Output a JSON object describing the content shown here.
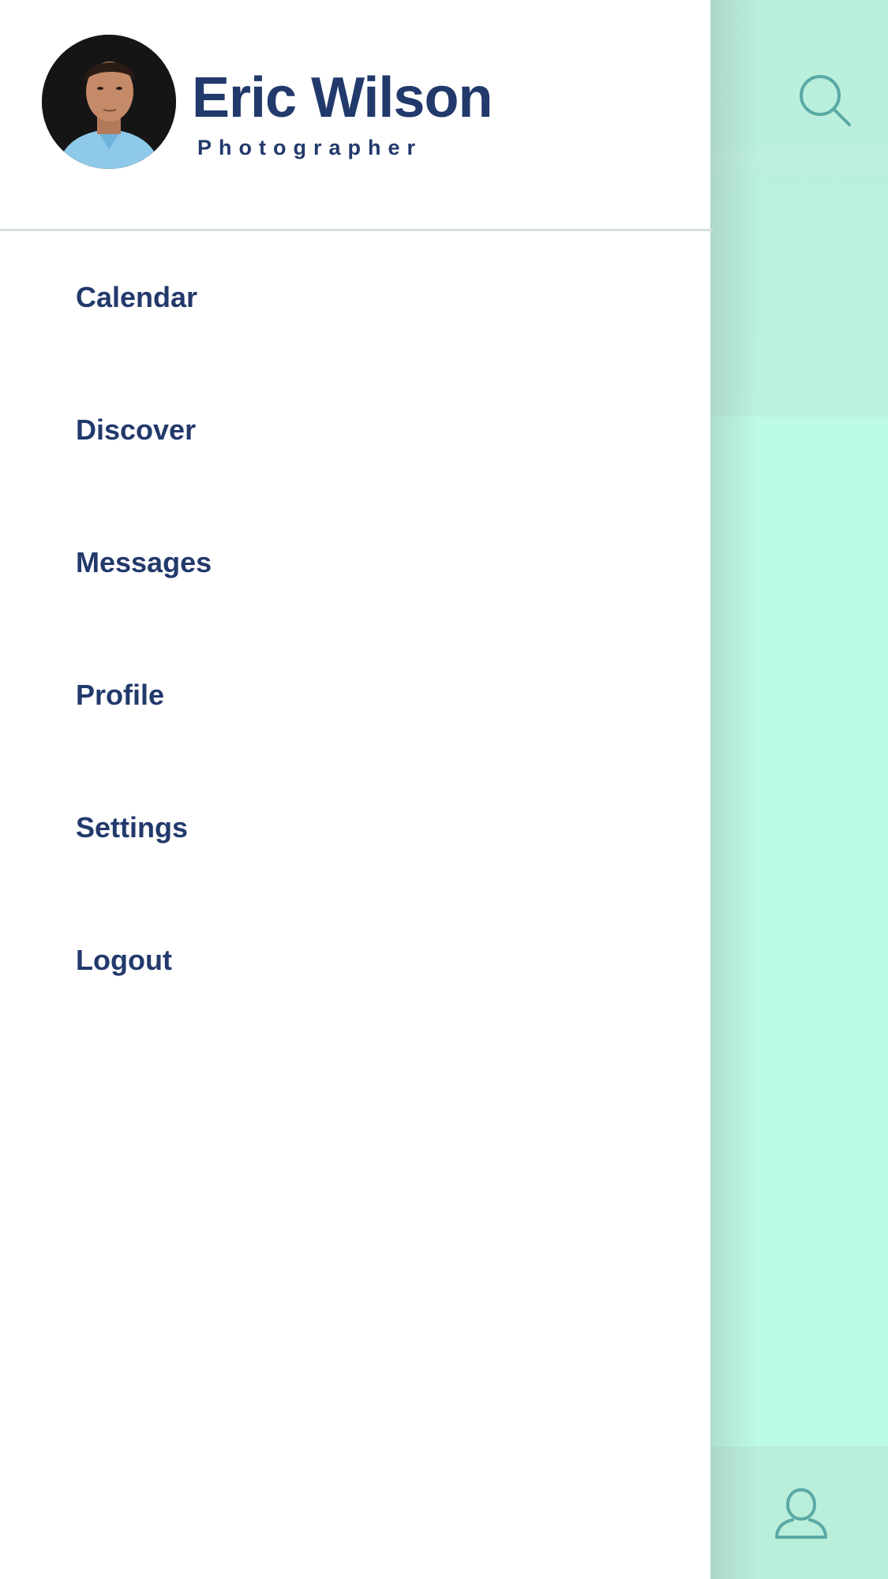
{
  "profile": {
    "name": "Eric Wilson",
    "role": "Photographer"
  },
  "menu": {
    "items": [
      {
        "label": "Calendar"
      },
      {
        "label": "Discover"
      },
      {
        "label": "Messages"
      },
      {
        "label": "Profile"
      },
      {
        "label": "Settings"
      },
      {
        "label": "Logout"
      }
    ]
  },
  "icons": {
    "search": "search-icon",
    "user": "user-icon"
  },
  "colors": {
    "text_primary": "#22396b",
    "accent_mint": "#bcfbe5",
    "icon_teal": "#5aa9a4",
    "divider": "#d6dedd"
  }
}
